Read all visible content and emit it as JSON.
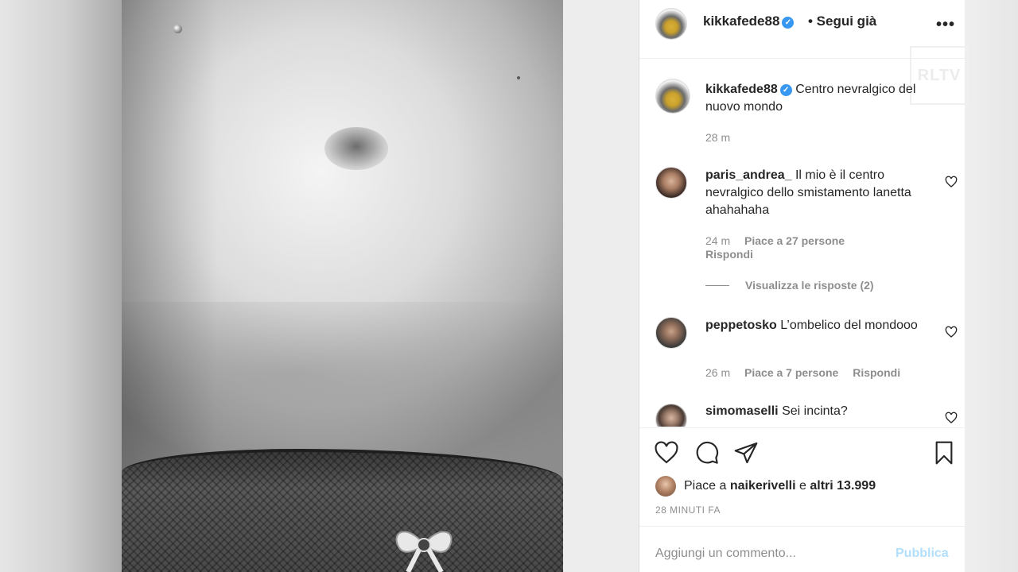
{
  "post": {
    "author": "kikkafede88",
    "follow_status": "• Segui già",
    "more_label": "•••",
    "watermark": "RLTV"
  },
  "caption": {
    "username": "kikkafede88",
    "text": "Centro nevralgico del nuovo mondo",
    "time": "28 m"
  },
  "comments": [
    {
      "username": "paris_andrea_",
      "text": "Il mio è il centro nevralgico dello smistamento lanetta ahahahaha",
      "time": "24 m",
      "likes": "Piace a 27 persone",
      "reply": "Rispondi"
    },
    {
      "username": "peppetosko",
      "text": "L’ombelico del mondooo",
      "time": "26 m",
      "likes": "Piace a 7 persone",
      "reply": "Rispondi"
    },
    {
      "username": "simomaselli",
      "text": "Sei incinta?"
    }
  ],
  "view_replies": "Visualizza le risposte (2)",
  "likes": {
    "prefix": "Piace a",
    "user": "naikerivelli",
    "middle": "e",
    "others": "altri 13.999"
  },
  "time_ago": "28 MINUTI FA",
  "add_comment": {
    "placeholder": "Aggiungi un commento...",
    "publish": "Pubblica"
  },
  "icons": {
    "verified": "verified-badge-icon",
    "like": "heart-icon",
    "comment": "comment-icon",
    "share": "paper-plane-icon",
    "save": "bookmark-icon",
    "more": "ellipsis-icon"
  },
  "colors": {
    "verified": "#3897f0",
    "publish_disabled": "#b2dffc",
    "muted": "#8e8e8e"
  }
}
